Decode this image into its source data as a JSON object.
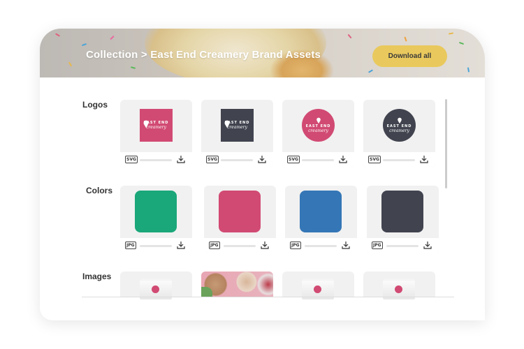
{
  "header": {
    "breadcrumb": "Collection > East End Creamery Brand Assets",
    "download_all_label": "Download all"
  },
  "sections": {
    "logos": {
      "label": "Logos",
      "items": [
        {
          "brand": "EAST END",
          "sub": "creamery",
          "bg": "#d14a73",
          "shape": "square",
          "file_type": "SVG"
        },
        {
          "brand": "EAST END",
          "sub": "creamery",
          "bg": "#41444f",
          "shape": "square",
          "file_type": "SVG"
        },
        {
          "brand": "EAST END",
          "sub": "creamery",
          "bg": "#d14a73",
          "shape": "circle",
          "file_type": "SVG"
        },
        {
          "brand": "EAST END",
          "sub": "creamery",
          "bg": "#41444f",
          "shape": "circle",
          "file_type": "SVG"
        }
      ]
    },
    "colors": {
      "label": "Colors",
      "items": [
        {
          "color": "#1aa77a",
          "file_type": "JPG"
        },
        {
          "color": "#d14a73",
          "file_type": "JPG"
        },
        {
          "color": "#3476b6",
          "file_type": "JPG"
        },
        {
          "color": "#41444f",
          "file_type": "JPG"
        }
      ]
    },
    "images": {
      "label": "Images",
      "items": [
        {
          "kind": "tub"
        },
        {
          "kind": "photo"
        },
        {
          "kind": "tub"
        },
        {
          "kind": "tub"
        }
      ]
    }
  },
  "icons": {
    "download": "download-icon",
    "file": "file-type-icon",
    "ice_cream": "ice-cream-icon"
  },
  "theme": {
    "accent": "#e9c95d",
    "brand_pink": "#d14a73",
    "brand_dark": "#41444f"
  }
}
